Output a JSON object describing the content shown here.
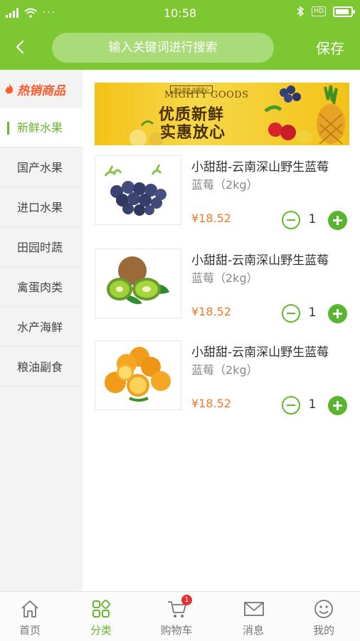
{
  "status_bar": {
    "time": "10:58",
    "network": "4G",
    "extra": "···",
    "hd": "HD"
  },
  "header": {
    "search_placeholder": "输入关键词进行搜索",
    "save_label": "保存"
  },
  "sidebar": {
    "hot_label": "热销商品",
    "categories": [
      {
        "label": "新鲜水果",
        "active": true
      },
      {
        "label": "国产水果",
        "active": false
      },
      {
        "label": "进口水果",
        "active": false
      },
      {
        "label": "田园时蔬",
        "active": false
      },
      {
        "label": "禽蛋肉类",
        "active": false
      },
      {
        "label": "水产海鲜",
        "active": false
      },
      {
        "label": "粮油副食",
        "active": false
      }
    ]
  },
  "banner": {
    "subtitle": "源头直供 品质放心",
    "english": "MIGHTY GOODS",
    "line1": "优质新鲜",
    "line2": "实惠放心"
  },
  "products": [
    {
      "name": "小甜甜-云南深山野生蓝莓",
      "spec": "蓝莓（2kg）",
      "price": "¥18.52",
      "qty": "1",
      "image": "blueberries"
    },
    {
      "name": "小甜甜-云南深山野生蓝莓",
      "spec": "蓝莓（2kg）",
      "price": "¥18.52",
      "qty": "1",
      "image": "kiwi"
    },
    {
      "name": "小甜甜-云南深山野生蓝莓",
      "spec": "蓝莓（2kg）",
      "price": "¥18.52",
      "qty": "1",
      "image": "oranges"
    }
  ],
  "tabbar": {
    "tabs": [
      {
        "label": "首页",
        "icon": "home-icon",
        "active": false
      },
      {
        "label": "分类",
        "icon": "category-icon",
        "active": true
      },
      {
        "label": "购物车",
        "icon": "cart-icon",
        "active": false,
        "badge": "1"
      },
      {
        "label": "消息",
        "icon": "mail-icon",
        "active": false
      },
      {
        "label": "我的",
        "icon": "smiley-icon",
        "active": false
      }
    ]
  },
  "colors": {
    "brand": "#7dc832",
    "accent_green": "#65b72e",
    "price": "#f2792a",
    "hot": "#ff5a2a"
  }
}
